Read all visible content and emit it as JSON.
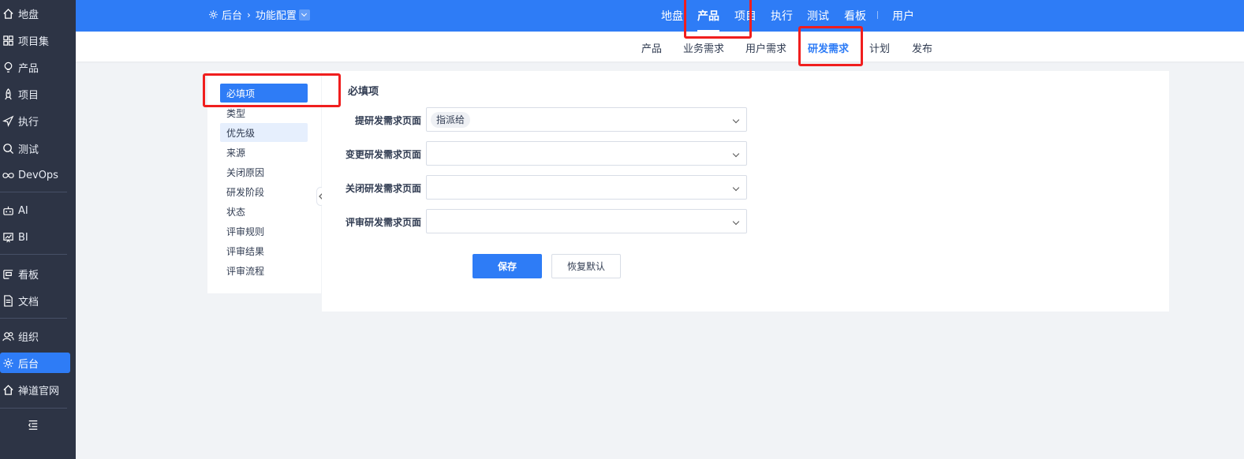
{
  "sidebar": {
    "items": [
      {
        "label": "地盘",
        "icon": "home-icon"
      },
      {
        "label": "项目集",
        "icon": "grid-icon"
      },
      {
        "label": "产品",
        "icon": "lightbulb-icon"
      },
      {
        "label": "项目",
        "icon": "rocket-icon"
      },
      {
        "label": "执行",
        "icon": "send-icon"
      },
      {
        "label": "测试",
        "icon": "search-icon"
      },
      {
        "label": "DevOps",
        "icon": "infinity-icon"
      },
      {
        "label": "AI",
        "icon": "robot-icon"
      },
      {
        "label": "BI",
        "icon": "chart-icon"
      },
      {
        "label": "看板",
        "icon": "kanban-icon"
      },
      {
        "label": "文档",
        "icon": "document-icon"
      },
      {
        "label": "组织",
        "icon": "users-icon"
      },
      {
        "label": "后台",
        "icon": "gear-icon"
      },
      {
        "label": "禅道官网",
        "icon": "home-icon"
      }
    ],
    "active_index": 12
  },
  "breadcrumb": {
    "root": "后台",
    "current": "功能配置"
  },
  "topnav": {
    "items": [
      "地盘",
      "产品",
      "项目",
      "执行",
      "测试",
      "看板",
      "用户"
    ],
    "active": "产品"
  },
  "subnav": {
    "items": [
      "产品",
      "业务需求",
      "用户需求",
      "研发需求",
      "计划",
      "发布"
    ],
    "active": "研发需求"
  },
  "leftmenu": {
    "items": [
      "必填项",
      "类型",
      "优先级",
      "来源",
      "关闭原因",
      "研发阶段",
      "状态",
      "评审规则",
      "评审结果",
      "评审流程"
    ],
    "active": "必填项",
    "hover": "优先级"
  },
  "main": {
    "title": "必填项",
    "rows": [
      {
        "label": "提研发需求页面",
        "tags": [
          "指派给"
        ]
      },
      {
        "label": "变更研发需求页面",
        "tags": []
      },
      {
        "label": "关闭研发需求页面",
        "tags": []
      },
      {
        "label": "评审研发需求页面",
        "tags": []
      }
    ],
    "save_label": "保存",
    "reset_label": "恢复默认"
  },
  "colors": {
    "primary": "#2e7cf6",
    "sidebar": "#2d3445",
    "highlight": "#f01e1e"
  }
}
